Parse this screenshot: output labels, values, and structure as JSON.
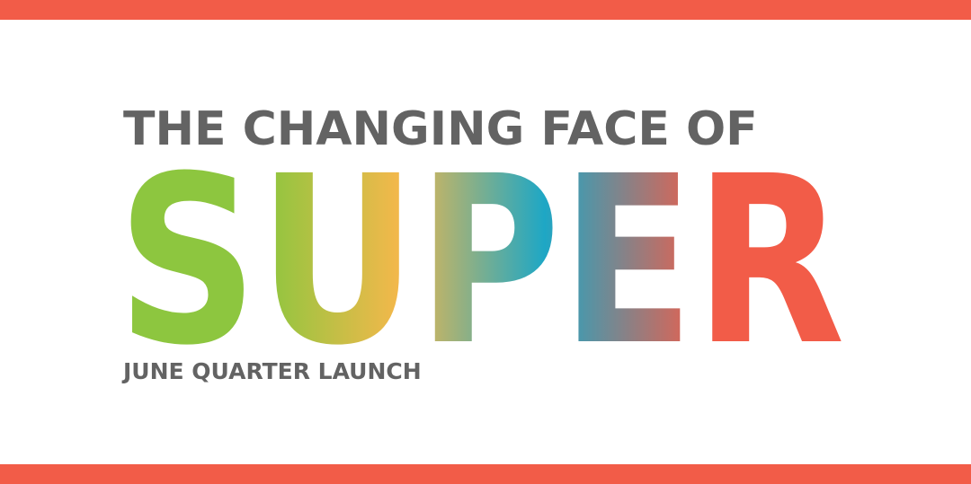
{
  "banner": {
    "headline": "THE CHANGING FACE OF",
    "main_word": "SUPER",
    "subline": "JUNE QUARTER LAUNCH"
  },
  "colors": {
    "stripe": "#f25c48",
    "headline_text": "#636363",
    "gradient_green": "#8dc63f",
    "gradient_yellow": "#f2b84b",
    "gradient_cyan": "#1ea7c5",
    "gradient_red": "#f25c48"
  }
}
